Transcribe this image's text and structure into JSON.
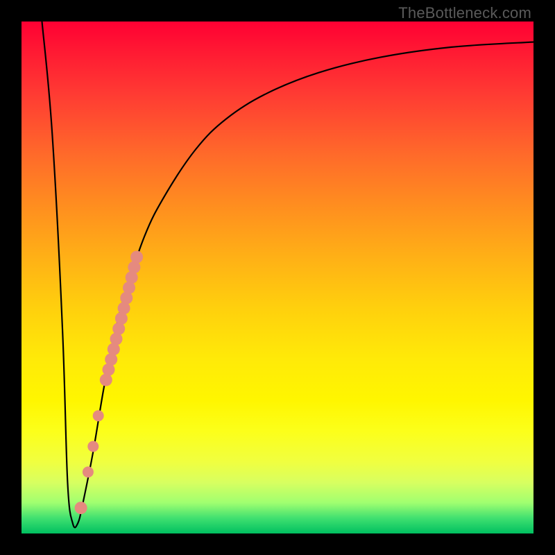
{
  "watermark": "TheBottleneck.com",
  "colors": {
    "curve_stroke": "#000000",
    "marker_fill": "#e58a7f",
    "frame_bg": "#000000"
  },
  "chart_data": {
    "type": "line",
    "title": "",
    "xlabel": "",
    "ylabel": "",
    "xlim": [
      0,
      100
    ],
    "ylim": [
      0,
      100
    ],
    "series": [
      {
        "name": "bottleneck-curve",
        "x": [
          4,
          6,
          8,
          9,
          10,
          11,
          12,
          14,
          16,
          18,
          20,
          24,
          28,
          34,
          40,
          48,
          58,
          70,
          84,
          100
        ],
        "y": [
          100,
          78,
          40,
          10,
          2,
          2,
          6,
          16,
          28,
          38,
          46,
          58,
          66,
          75,
          81,
          86,
          90,
          93,
          95,
          96
        ]
      }
    ],
    "markers": [
      {
        "name": "marker-band-top",
        "x": 22.5,
        "y": 54,
        "size": 9
      },
      {
        "name": "marker-band-1",
        "x": 22.0,
        "y": 52,
        "size": 9
      },
      {
        "name": "marker-band-2",
        "x": 21.5,
        "y": 50,
        "size": 9
      },
      {
        "name": "marker-band-3",
        "x": 21.0,
        "y": 48,
        "size": 9
      },
      {
        "name": "marker-band-4",
        "x": 20.5,
        "y": 46,
        "size": 9
      },
      {
        "name": "marker-band-5",
        "x": 20.0,
        "y": 44,
        "size": 9
      },
      {
        "name": "marker-band-6",
        "x": 19.5,
        "y": 42,
        "size": 9
      },
      {
        "name": "marker-band-7",
        "x": 19.0,
        "y": 40,
        "size": 9
      },
      {
        "name": "marker-band-8",
        "x": 18.5,
        "y": 38,
        "size": 9
      },
      {
        "name": "marker-band-9",
        "x": 18.0,
        "y": 36,
        "size": 9
      },
      {
        "name": "marker-band-10",
        "x": 17.5,
        "y": 34,
        "size": 9
      },
      {
        "name": "marker-band-11",
        "x": 17.0,
        "y": 32,
        "size": 9
      },
      {
        "name": "marker-band-bot",
        "x": 16.5,
        "y": 30,
        "size": 9
      },
      {
        "name": "marker-dot-a",
        "x": 15.0,
        "y": 23,
        "size": 8
      },
      {
        "name": "marker-dot-b",
        "x": 14.0,
        "y": 17,
        "size": 8
      },
      {
        "name": "marker-dot-c",
        "x": 13.0,
        "y": 12,
        "size": 8
      },
      {
        "name": "marker-dot-d",
        "x": 11.6,
        "y": 5,
        "size": 9
      }
    ]
  }
}
